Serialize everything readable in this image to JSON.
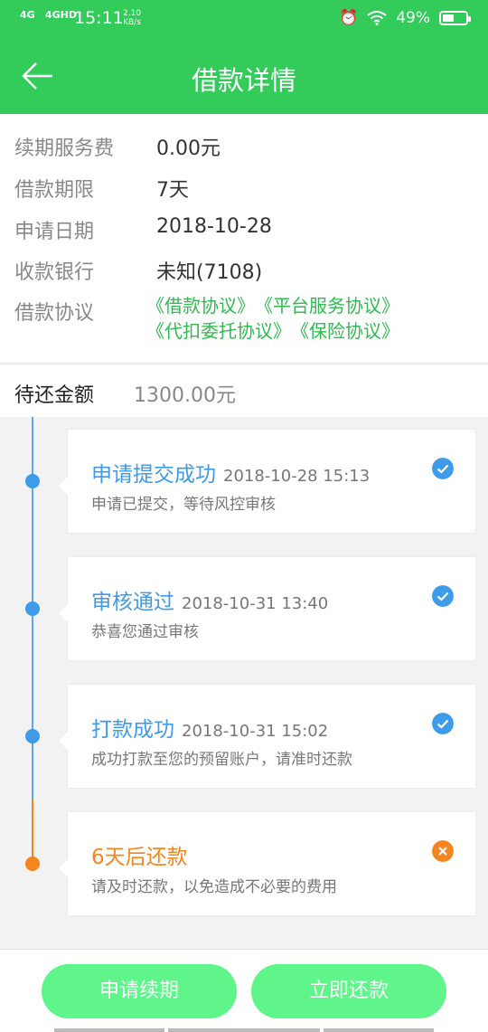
{
  "status_bar": {
    "network1": "4G",
    "network2": "4GHD",
    "time": "15:11",
    "speed": "2.10",
    "speed_unit": "KB/s",
    "battery": "49%",
    "battery_level": 0.49
  },
  "header": {
    "title": "借款详情"
  },
  "info": {
    "rows": [
      {
        "label": "续期服务费",
        "value": "0.00元"
      },
      {
        "label": "借款期限",
        "value": "7天"
      },
      {
        "label": "申请日期",
        "value": "2018-10-28"
      },
      {
        "label": "收款银行",
        "value": "未知(7108)"
      }
    ],
    "agreement_label": "借款协议",
    "agreements": [
      "《借款协议》",
      "《平台服务协议》",
      "《代扣委托协议》",
      "《保险协议》"
    ]
  },
  "repay": {
    "label": "待还金额",
    "value": "1300.00元"
  },
  "timeline": [
    {
      "title": "申请提交成功",
      "time": "2018-10-28 15:13",
      "desc": "申请已提交，等待风控审核",
      "state": "done"
    },
    {
      "title": "审核通过",
      "time": "2018-10-31 13:40",
      "desc": "恭喜您通过审核",
      "state": "done"
    },
    {
      "title": "打款成功",
      "time": "2018-10-31 15:02",
      "desc": "成功打款至您的预留账户，请准时还款",
      "state": "done"
    },
    {
      "title": "6天后还款",
      "time": "",
      "desc": "请及时还款，以免造成不必要的费用",
      "state": "pending"
    }
  ],
  "colors": {
    "green": "#33cc5a",
    "blue": "#3d9be9",
    "orange": "#f5861f",
    "button": "#5ff58a"
  },
  "buttons": {
    "renew": "申请续期",
    "repay_now": "立即还款"
  }
}
